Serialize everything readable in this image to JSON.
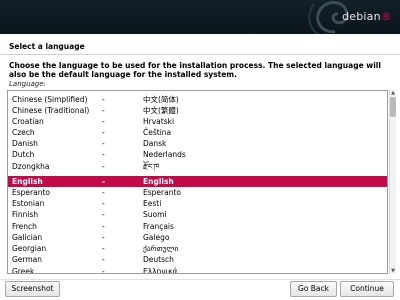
{
  "banner": {
    "logo_text": "debian",
    "logo_mark": "®",
    "brand_color": "#d70a53"
  },
  "page": {
    "title": "Select a language",
    "description": "Choose the language to be used for the installation process. The selected language will also be the default language for the installed system.",
    "list_label": "Language:"
  },
  "languages": [
    {
      "name": "Chinese (Simplified)",
      "native": "中文(简体)"
    },
    {
      "name": "Chinese (Traditional)",
      "native": "中文(繁體)"
    },
    {
      "name": "Croatian",
      "native": "Hrvatski"
    },
    {
      "name": "Czech",
      "native": "Čeština"
    },
    {
      "name": "Danish",
      "native": "Dansk"
    },
    {
      "name": "Dutch",
      "native": "Nederlands"
    },
    {
      "name": "Dzongkha",
      "native": "རྫོང་ཁ"
    },
    {
      "name": "English",
      "native": "English",
      "selected": true
    },
    {
      "name": "Esperanto",
      "native": "Esperanto"
    },
    {
      "name": "Estonian",
      "native": "Eesti"
    },
    {
      "name": "Finnish",
      "native": "Suomi"
    },
    {
      "name": "French",
      "native": "Français"
    },
    {
      "name": "Galician",
      "native": "Galego"
    },
    {
      "name": "Georgian",
      "native": "ქართული"
    },
    {
      "name": "German",
      "native": "Deutsch"
    },
    {
      "name": "Greek",
      "native": "Ελληνικά"
    }
  ],
  "separator": "-",
  "colors": {
    "selection": "#c20a4b"
  },
  "buttons": {
    "screenshot": "Screenshot",
    "go_back": "Go Back",
    "continue": "Continue"
  }
}
